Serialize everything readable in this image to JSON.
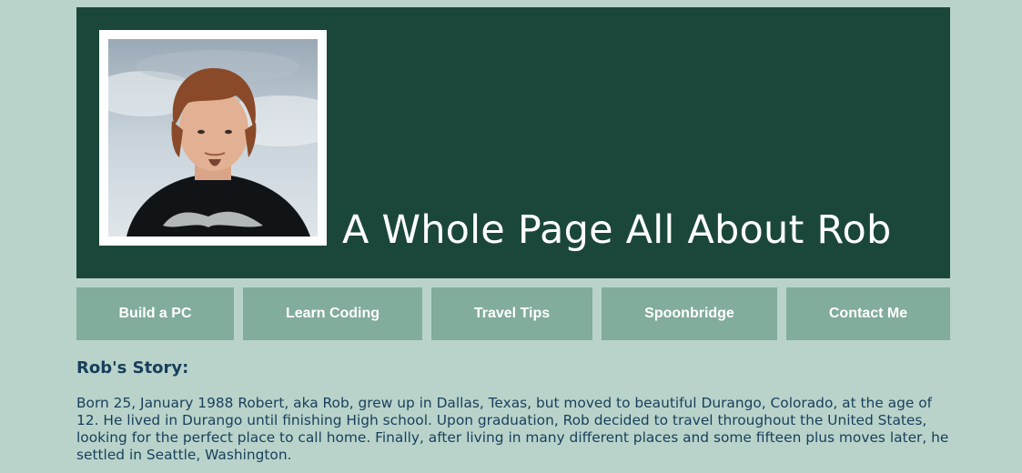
{
  "header": {
    "title": "A Whole Page All About Rob"
  },
  "nav": {
    "items": [
      {
        "label": "Build a PC"
      },
      {
        "label": "Learn Coding"
      },
      {
        "label": "Travel Tips"
      },
      {
        "label": "Spoonbridge"
      },
      {
        "label": "Contact Me"
      }
    ]
  },
  "story": {
    "heading": "Rob's Story:",
    "text": "Born 25, January 1988 Robert, aka Rob, grew up in Dallas, Texas, but moved to beautiful Durango, Colorado, at the age of 12. He lived in Durango until finishing High school. Upon graduation, Rob decided to travel throughout the United States, looking for the perfect place to call home. Finally, after living in many different places and some fifteen plus moves later, he settled in Seattle, Washington."
  },
  "colors": {
    "background": "#b9d3cb",
    "header_bg": "#1b473b",
    "nav_bg": "#82ac9c",
    "text": "#173f5a"
  }
}
